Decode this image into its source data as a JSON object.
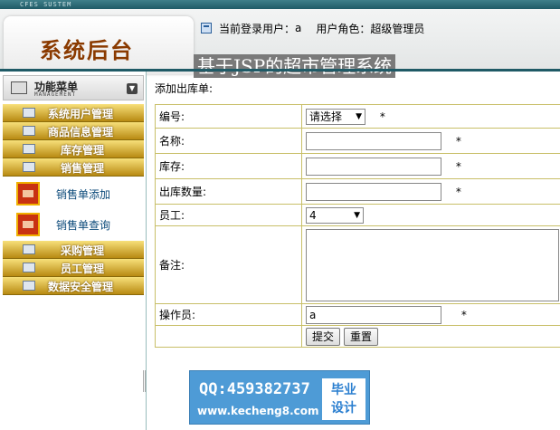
{
  "header": {
    "brand_small": "CFES SUSTEM",
    "logo_text": "系统后台",
    "current_user_label": "当前登录用户：",
    "current_user_value": "a",
    "role_label": "用户角色：",
    "role_value": "超级管理员",
    "system_title": "基于JSP的超市管理系统"
  },
  "sidebar": {
    "menu_title": "功能菜单",
    "menu_subtitle": "MANAGEMENT",
    "toggle_glyph": "▼",
    "items": [
      {
        "label": "系统用户管理"
      },
      {
        "label": "商品信息管理"
      },
      {
        "label": "库存管理"
      },
      {
        "label": "销售管理"
      },
      {
        "label": "采购管理"
      },
      {
        "label": "员工管理"
      },
      {
        "label": "数据安全管理"
      }
    ],
    "sub_items": [
      {
        "label": "销售单添加"
      },
      {
        "label": "销售单查询"
      }
    ]
  },
  "form": {
    "heading": "添加出库单:",
    "required_mark": "*",
    "fields": {
      "code": {
        "label": "编号:",
        "selected": "请选择"
      },
      "name": {
        "label": "名称:",
        "value": ""
      },
      "stock": {
        "label": "库存:",
        "value": ""
      },
      "out_qty": {
        "label": "出库数量:",
        "value": ""
      },
      "employee": {
        "label": "员工:",
        "selected": "4"
      },
      "remark": {
        "label": "备注:",
        "value": ""
      },
      "operator": {
        "label": "操作员:",
        "value": "a"
      }
    },
    "submit_label": "提交",
    "reset_label": "重置"
  },
  "watermark": {
    "qq": "QQ:459382737",
    "site": "www.kecheng8.com",
    "box_line1": "毕业",
    "box_line2": "设计"
  }
}
